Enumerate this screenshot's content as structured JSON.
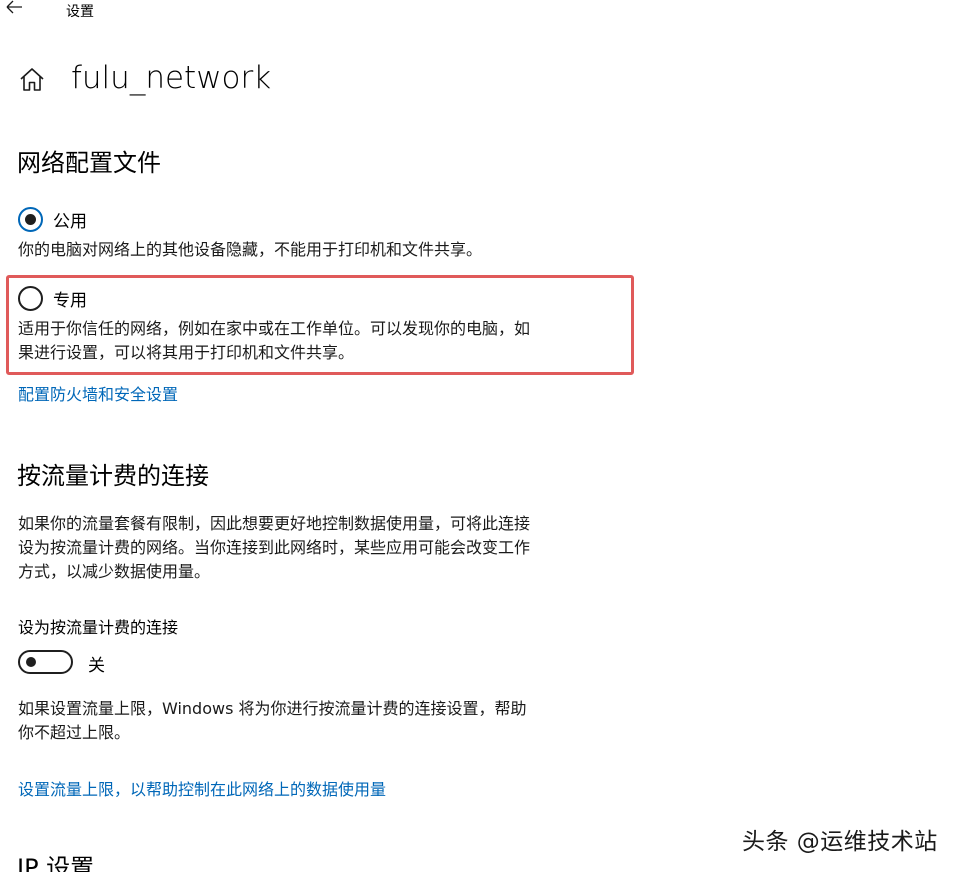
{
  "titlebar": {
    "title": "设置"
  },
  "header": {
    "title": "fulu_network"
  },
  "profile": {
    "heading": "网络配置文件",
    "public": {
      "label": "公用",
      "desc": "你的电脑对网络上的其他设备隐藏，不能用于打印机和文件共享。",
      "selected": true
    },
    "private": {
      "label": "专用",
      "desc_line1": "适用于你信任的网络，例如在家中或在工作单位。可以发现你的电脑，如",
      "desc_line2": "果进行设置，可以将其用于打印机和文件共享。",
      "selected": false
    },
    "firewall_link": "配置防火墙和安全设置"
  },
  "metered": {
    "heading": "按流量计费的连接",
    "desc_line1": "如果你的流量套餐有限制，因此想要更好地控制数据使用量，可将此连接",
    "desc_line2": "设为按流量计费的网络。当你连接到此网络时，某些应用可能会改变工作",
    "desc_line3": "方式，以减少数据使用量。",
    "toggle_label": "设为按流量计费的连接",
    "toggle_state": "关",
    "toggle_on": false,
    "limit_desc_line1": "如果设置流量上限，Windows 将为你进行按流量计费的连接设置，帮助",
    "limit_desc_line2": "你不超过上限。",
    "limit_link": "设置流量上限，以帮助控制在此网络上的数据使用量"
  },
  "ip": {
    "heading": "IP 设置"
  },
  "watermark": "头条 @运维技术站",
  "colors": {
    "accent": "#0067b8",
    "highlight": "#e05a5a"
  }
}
